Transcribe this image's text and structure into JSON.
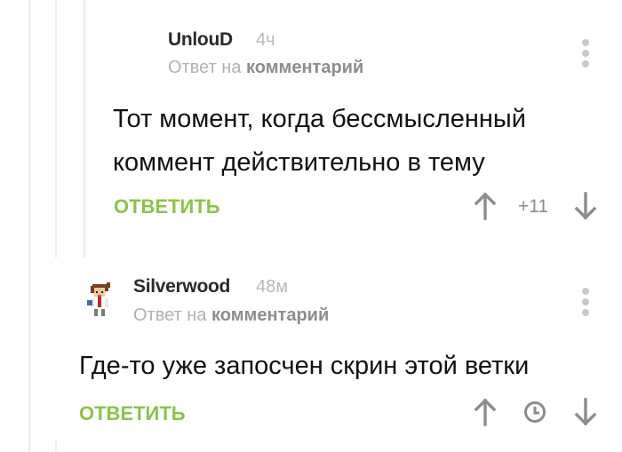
{
  "thread": {
    "comments": [
      {
        "author": "UnlouD",
        "time": "4ч",
        "reply_prefix": "Ответ на",
        "reply_target": "комментарий",
        "text_lines": [
          "Тот момент, когда бессмысленный",
          "коммент действительно в тему"
        ],
        "reply_label": "ОТВЕТИТЬ",
        "rating": "+11",
        "icons": [
          "arrow-up-icon",
          "arrow-down-icon",
          "more-vertical-icon"
        ]
      },
      {
        "author": "Silverwood",
        "time": "48м",
        "reply_prefix": "Ответ на",
        "reply_target": "комментарий",
        "text_lines": [
          "Где-то уже запосчен скрин этой ветки"
        ],
        "reply_label": "ОТВЕТИТЬ",
        "icons": [
          "arrow-up-icon",
          "clock-icon",
          "arrow-down-icon",
          "more-vertical-icon",
          "pixel-avatar-icon"
        ]
      }
    ]
  },
  "colors": {
    "accent_green": "#8bc34a",
    "author": "#2a2a2a",
    "muted": "#b1b1b1",
    "icon": "#8c8c8c",
    "thread_line": "#ececec"
  }
}
